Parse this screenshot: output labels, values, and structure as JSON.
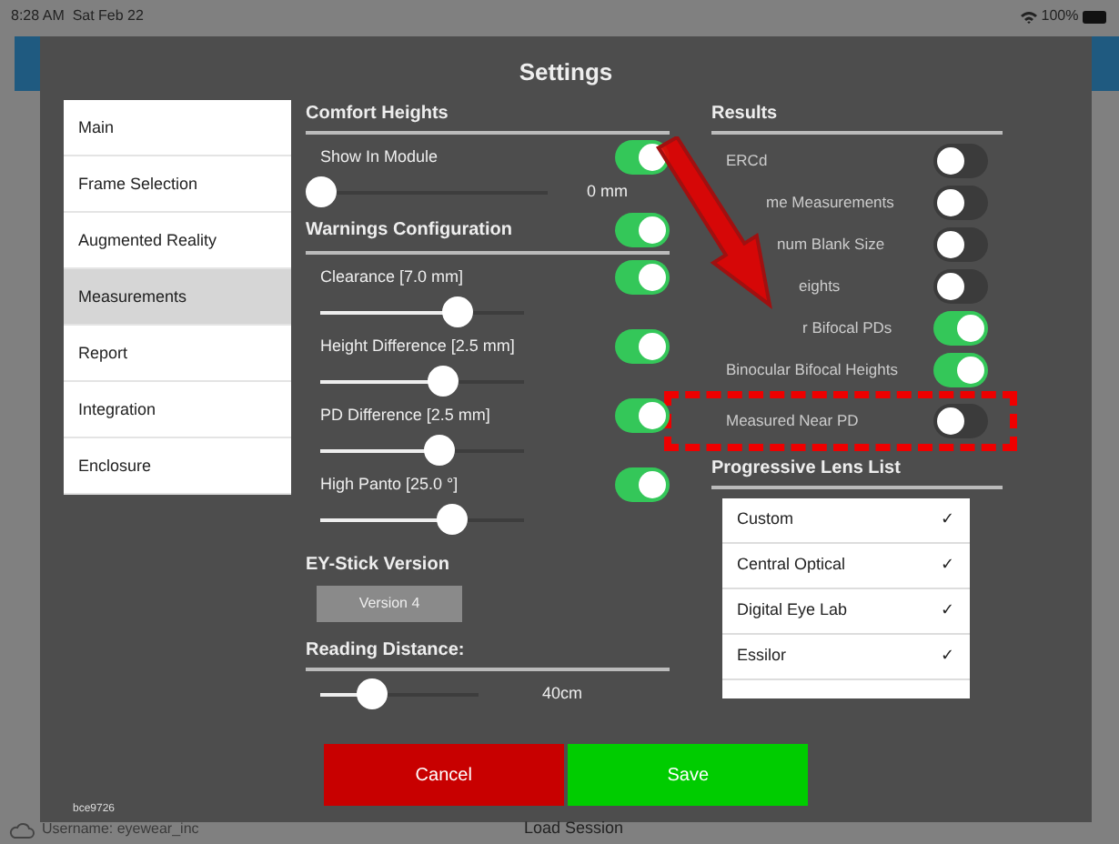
{
  "status_bar": {
    "time": "8:28 AM",
    "date": "Sat Feb 22",
    "battery": "100%"
  },
  "dialog": {
    "title": "Settings"
  },
  "sidebar": {
    "items": [
      {
        "label": "Main",
        "selected": false
      },
      {
        "label": "Frame Selection",
        "selected": false
      },
      {
        "label": "Augmented Reality",
        "selected": false
      },
      {
        "label": "Measurements",
        "selected": true
      },
      {
        "label": "Report",
        "selected": false
      },
      {
        "label": "Integration",
        "selected": false
      },
      {
        "label": "Enclosure",
        "selected": false
      }
    ]
  },
  "comfort_heights": {
    "title": "Comfort Heights",
    "label": "Show In Module",
    "on": true,
    "level": 0,
    "reading": "0 mm"
  },
  "warnings": {
    "title": "Warnings Configuration",
    "on": true,
    "rows": [
      {
        "label": "Clearance  [7.0 mm]",
        "on": true,
        "level": 0.67
      },
      {
        "label": "Height Difference  [2.5 mm]",
        "on": true,
        "level": 0.6
      },
      {
        "label": "PD Difference  [2.5 mm]",
        "on": true,
        "level": 0.58
      },
      {
        "label": "High Panto  [25.0 °]",
        "on": true,
        "level": 0.64
      }
    ]
  },
  "ey_stick": {
    "title": "EY-Stick Version",
    "button": "Version 4"
  },
  "reading_distance": {
    "title": "Reading Distance:",
    "level": 0.32,
    "reading": "40cm"
  },
  "results": {
    "title": "Results",
    "rows": [
      {
        "label": "ERCd",
        "on": false,
        "highlighted": false
      },
      {
        "label": "me Measurements",
        "on": false,
        "highlighted": false
      },
      {
        "label": "num Blank Size",
        "on": false,
        "highlighted": false
      },
      {
        "label": "eights",
        "on": false,
        "highlighted": false
      },
      {
        "label": "r Bifocal PDs",
        "on": true,
        "highlighted": false
      },
      {
        "label": "Binocular Bifocal Heights",
        "on": true,
        "highlighted": false
      },
      {
        "label": "Measured Near PD",
        "on": false,
        "highlighted": true
      }
    ]
  },
  "progressive_lens_list": {
    "title": "Progressive Lens List",
    "items": [
      {
        "label": "Custom",
        "checked": true,
        "check": "✓"
      },
      {
        "label": "Central Optical",
        "checked": true,
        "check": "✓"
      },
      {
        "label": "Digital Eye Lab",
        "checked": true,
        "check": "✓"
      },
      {
        "label": "Essilor",
        "checked": true,
        "check": "✓"
      }
    ]
  },
  "buttons": [
    {
      "label": "Cancel",
      "kind": "cancel"
    },
    {
      "label": "Save",
      "kind": "save"
    }
  ],
  "build": "bce9726",
  "footer": {
    "username": "Username: eyewear_inc",
    "action": "Load Session"
  }
}
